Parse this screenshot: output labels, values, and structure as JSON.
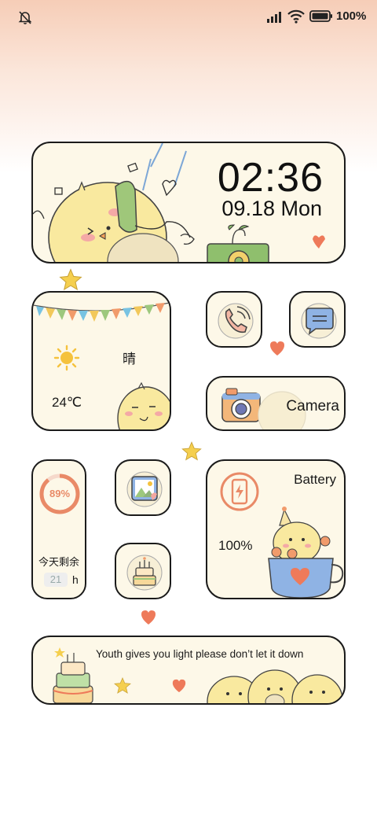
{
  "status_bar": {
    "battery_percent": "100%",
    "icons": [
      "mute-bell-icon",
      "signal-icon",
      "wifi-icon",
      "battery-icon"
    ]
  },
  "clock_widget": {
    "time": "02:36",
    "date": "09.18 Mon"
  },
  "weather_widget": {
    "condition": "晴",
    "temperature": "24℃",
    "icon": "sun-icon"
  },
  "apps": {
    "phone": {
      "icon": "phone-icon"
    },
    "messages": {
      "icon": "message-icon"
    },
    "gallery": {
      "icon": "gallery-icon"
    },
    "calendar": {
      "icon": "birthday-cake-icon"
    },
    "camera": {
      "label": "Camera",
      "icon": "camera-icon"
    }
  },
  "countdown_widget": {
    "percent": "89%",
    "progress": 0.89,
    "label": "今天剩余",
    "hours": "21",
    "unit": "h"
  },
  "battery_widget": {
    "title": "Battery",
    "value": "100%",
    "icon": "phone-charging-icon"
  },
  "quote_widget": {
    "text": "Youth gives you light please don’t let it down"
  },
  "colors": {
    "card_bg": "#fdf8e8",
    "border": "#1b1b1b",
    "accent_orange": "#e98a67",
    "heart": "#ee7a5a",
    "star": "#f5cf4e"
  }
}
